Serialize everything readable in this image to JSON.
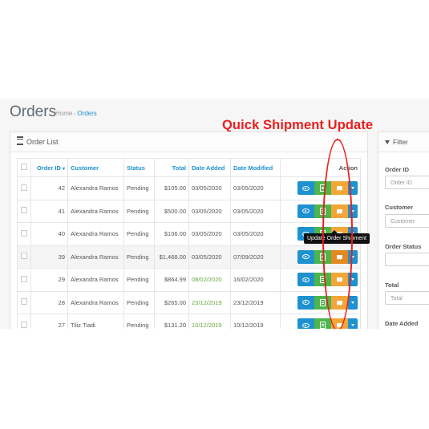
{
  "header": {
    "title": "Orders",
    "breadcrumb": [
      "Home",
      "Orders"
    ]
  },
  "callout": "Quick Shipment Update",
  "order_list": {
    "heading": "Order List",
    "columns": [
      "Order ID",
      "Customer",
      "Status",
      "Total",
      "Date Added",
      "Date Modified",
      "Action"
    ],
    "sort_indicator": "chevron-down",
    "rows": [
      {
        "id": "42",
        "customer": "Alexandra Ramos",
        "status": "Pending",
        "total": "$105.00",
        "added": "03/05/2020",
        "modified": "03/05/2020"
      },
      {
        "id": "41",
        "customer": "Alexandra Ramos",
        "status": "Pending",
        "total": "$500.00",
        "added": "03/05/2020",
        "modified": "03/05/2020"
      },
      {
        "id": "40",
        "customer": "Alexandra Ramos",
        "status": "Pending",
        "total": "$106.00",
        "added": "03/05/2020",
        "modified": "03/05/2020"
      },
      {
        "id": "39",
        "customer": "Alexandra Ramos",
        "status": "Pending",
        "total": "$1,468.00",
        "added": "03/05/2020",
        "modified": "07/09/2020"
      },
      {
        "id": "29",
        "customer": "Alexandra Ramos",
        "status": "Pending",
        "total": "$864.99",
        "added": "08/02/2020",
        "modified": "16/02/2020"
      },
      {
        "id": "28",
        "customer": "Alexandra Ramos",
        "status": "Pending",
        "total": "$265.00",
        "added": "23/12/2019",
        "modified": "23/12/2019"
      },
      {
        "id": "27",
        "customer": "Tiliz Tiadi",
        "status": "Pending",
        "total": "$131.20",
        "added": "10/12/2019",
        "modified": "10/12/2019"
      }
    ],
    "tooltip": "Update Order Shipment",
    "action_icons": [
      "eye-icon",
      "file-pdf-icon",
      "truck-icon",
      "caret-down-icon"
    ],
    "colors": {
      "view": "#1e91cf",
      "invoice": "#4cb64c",
      "shipment": "#f3a638",
      "link": "#1e91cf",
      "date_added": "#6ba83f",
      "annotation": "#ea1d1d"
    }
  },
  "filter": {
    "heading": "Filter",
    "fields": [
      {
        "label": "Order ID",
        "placeholder": "Order ID"
      },
      {
        "label": "Customer",
        "placeholder": "Customer"
      },
      {
        "label": "Order Status",
        "placeholder": ""
      },
      {
        "label": "Total",
        "placeholder": "Total"
      },
      {
        "label": "Date Added",
        "placeholder": ""
      }
    ]
  }
}
